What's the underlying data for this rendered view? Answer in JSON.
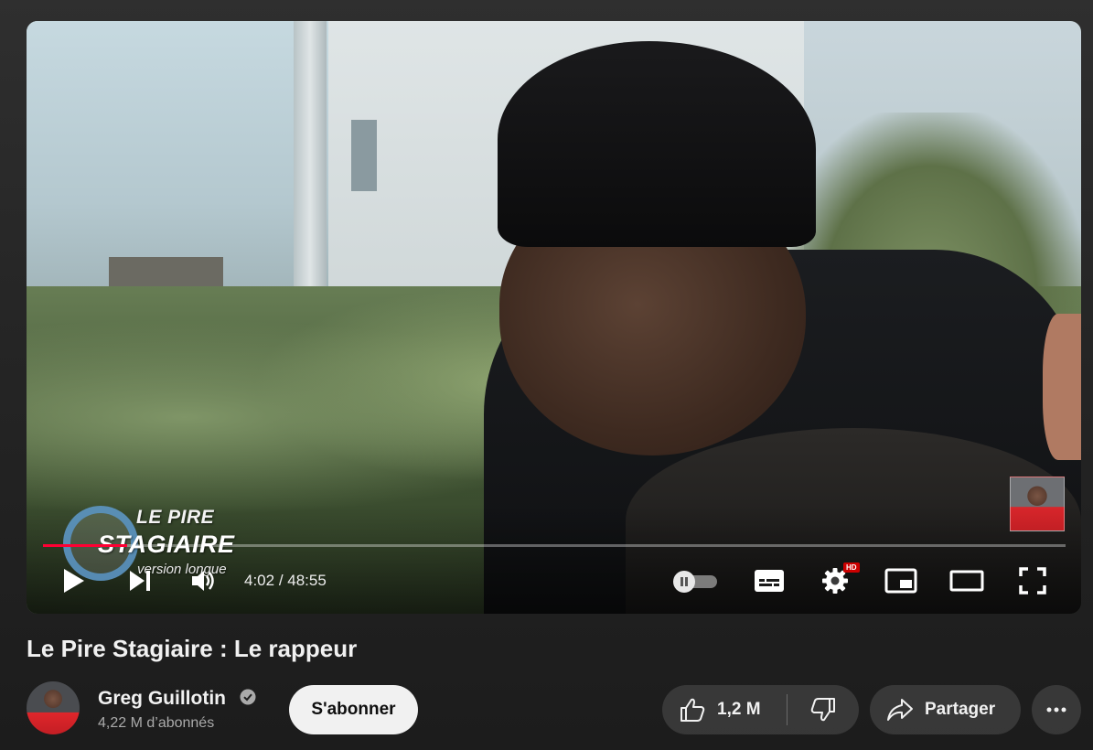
{
  "player": {
    "logo": {
      "line1": "LE PIRE",
      "line2": "STAGIAIRE",
      "line3": "version longue"
    },
    "progress_fraction": 0.0824,
    "time": {
      "current": "4:02",
      "separator": " / ",
      "duration": "48:55"
    },
    "hd_badge": "HD",
    "accent_color": "#ff0033"
  },
  "video": {
    "title": "Le Pire Stagiaire : Le rappeur"
  },
  "channel": {
    "name": "Greg Guillotin",
    "subscribers": "4,22 M d’abonnés",
    "subscribe_label": "S'abonner"
  },
  "actions": {
    "like_count": "1,2 M",
    "share_label": "Partager"
  },
  "icons": {
    "play": "play-icon",
    "next": "next-icon",
    "volume": "volume-icon",
    "autoplay": "autoplay-toggle",
    "subtitles": "subtitles-icon",
    "settings": "settings-icon",
    "miniplayer": "miniplayer-icon",
    "theater": "theater-icon",
    "fullscreen": "fullscreen-icon",
    "verified": "verified-icon",
    "like": "thumbs-up-icon",
    "dislike": "thumbs-down-icon",
    "share": "share-icon",
    "more": "more-icon"
  }
}
